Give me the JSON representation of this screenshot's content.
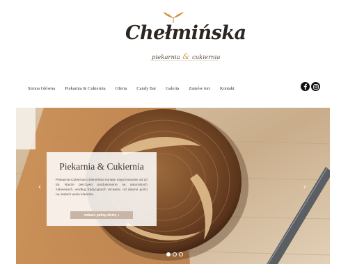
{
  "logo": {
    "name": "Chełmińska",
    "tagline_left": "piekarnia",
    "tagline_amp": "&",
    "tagline_right": "cukiernia",
    "wheat_icon": "wheat-icon"
  },
  "nav": {
    "items": [
      {
        "label": "Strona Główna"
      },
      {
        "label": "Piekarnia & Cukiernia"
      },
      {
        "label": "Oferta"
      },
      {
        "label": "Candy Bar"
      },
      {
        "label": "Galeria"
      },
      {
        "label": "Zamów tort"
      },
      {
        "label": "Kontakt"
      }
    ]
  },
  "social": {
    "facebook_icon": "facebook-icon",
    "instagram_icon": "instagram-icon"
  },
  "hero": {
    "card": {
      "title": "Piekarnia & Cukiernia",
      "text": "Piekarnia-Cukiernia Chełmińska istnieje nieprzerwanie od 20 lat. Nasze pieczywo produkowane na naturalnych zakwasach, według tradycyjnych receptur, od dawna gości na stołach wielu klientów.",
      "button_label": "zobacz pełną ofertę »"
    },
    "prev_arrow": "‹",
    "next_arrow": "›",
    "slides": 3,
    "active_slide": 1
  },
  "colors": {
    "accent": "#cf8a3f",
    "button": "#c9b5a3"
  }
}
